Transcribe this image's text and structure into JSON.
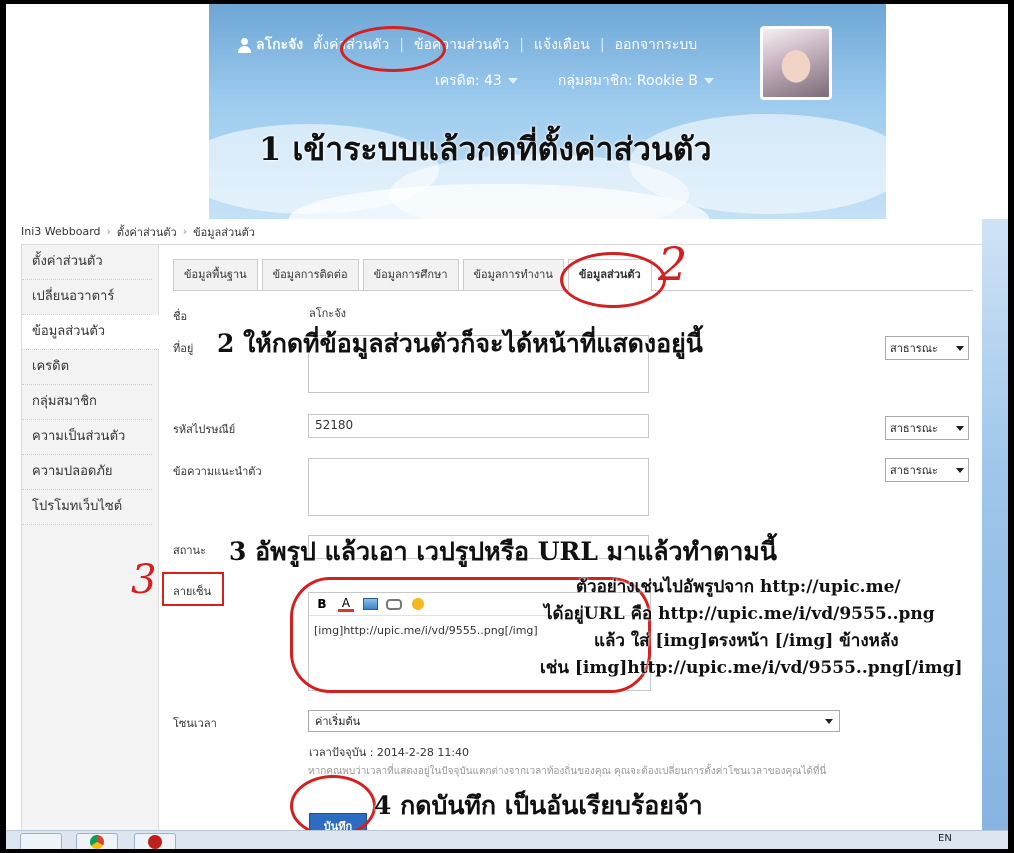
{
  "banner": {
    "username": "ลโกะจัง",
    "nav": [
      "ตั้งค่าส่วนตัว",
      "ข้อความส่วนตัว",
      "แจ้งเตือน",
      "ออกจากระบบ"
    ],
    "credit": "เครดิต: 43",
    "group": "กลุ่มสมาชิก: Rookie B",
    "caption": "1 เข้าระบบแล้วกดที่ตั้งค่าส่วนตัว"
  },
  "breadcrumb": [
    "Ini3 Webboard",
    "ตั้งค่าส่วนตัว",
    "ข้อมูลส่วนตัว"
  ],
  "sidebar": {
    "items": [
      "ตั้งค่าส่วนตัว",
      "เปลี่ยนอวาตาร์",
      "ข้อมูลส่วนตัว",
      "เครดิต",
      "กลุ่มสมาชิก",
      "ความเป็นส่วนตัว",
      "ความปลอดภัย",
      "โปรโมทเว็บไซต์"
    ],
    "active_index": 2
  },
  "tabs": [
    "ข้อมูลพื้นฐาน",
    "ข้อมูลการติดต่อ",
    "ข้อมูลการศึกษา",
    "ข้อมูลการทำงาน",
    "ข้อมูลส่วนตัว"
  ],
  "form": {
    "name_label": "ชื่อ",
    "name_value": "ลโกะจัง",
    "address_label": "ที่อยู่",
    "zip_label": "รหัสไปรษณีย์",
    "zip_value": "52180",
    "bio_label": "ข้อความแนะนำตัว",
    "status_label": "สถานะ",
    "signature_label": "ลายเซ็น",
    "signature_value": "[img]http://upic.me/i/vd/9555..png[/img]",
    "timezone_label": "โซนเวลา",
    "timezone_value": "ค่าเริ่มต้น",
    "current_time": "เวลาปัจจุบัน : 2014-2-28 11:40",
    "timezone_note": "หากคุณพบว่าเวลาที่แสดงอยู่ในปัจจุบันแตกต่างจากเวลาท้องถิ่นของคุณ คุณจะต้องเปลี่ยนการตั้งค่าโซนเวลาของคุณได้ที่นี่",
    "privacy_value": "สาธารณะ",
    "save_label": "บันทึก"
  },
  "annotations": {
    "step2": "2 ให้กดที่ข้อมูลส่วนตัวก็จะได้หน้าที่แสดงอยู่นี้",
    "step3": "3 อัพรูป แล้วเอา เวปรูปหรือ URL มาแล้วทำตามนี้",
    "example1": "ตัวอย่างเช่นไปอัพรูปจาก http://upic.me/",
    "example2": "ได้อยู่URL คือ http://upic.me/i/vd/9555..png",
    "example3": "แล้ว ใส่ [img]ตรงหน้า [/img] ข้างหลัง",
    "example4": "เช่น [img]http://upic.me/i/vd/9555..png[/img]",
    "step4": "4 กดบันทึก เป็นอันเรียบร้อยจ้า",
    "mark2": "2",
    "mark3": "3"
  },
  "taskbar": {
    "lang": "EN"
  },
  "colors": {
    "accent": "#2e6cc2",
    "annotation_red": "#d32020"
  }
}
